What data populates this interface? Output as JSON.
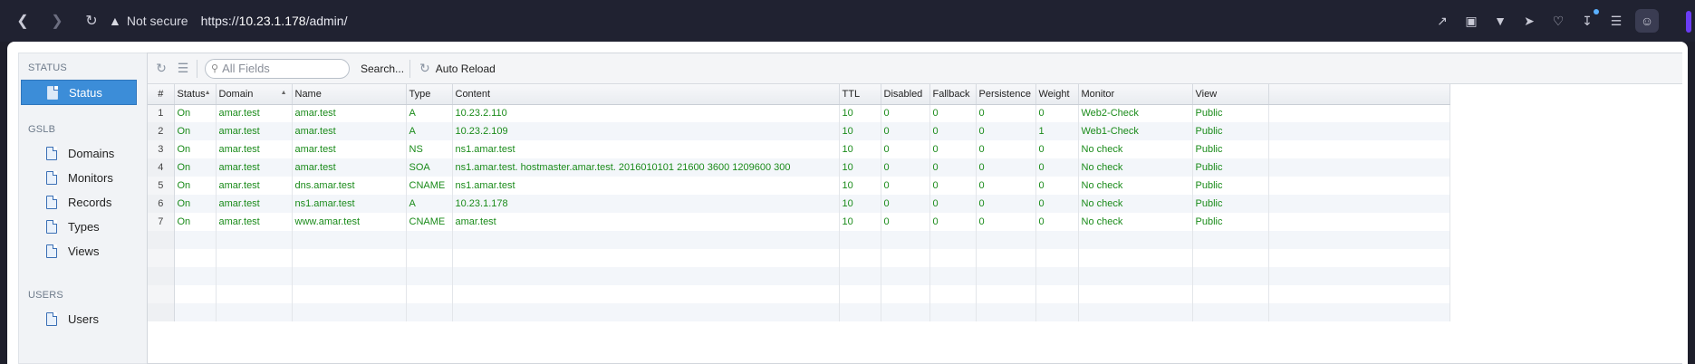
{
  "browser": {
    "security_label": "Not secure",
    "url_prefix": "https://",
    "url_host": "10.23.1.178",
    "url_path": "/admin/"
  },
  "sidebar": {
    "sections": {
      "status": "STATUS",
      "gslb": "GSLB",
      "users": "USERS"
    },
    "items": {
      "status": "Status",
      "domains": "Domains",
      "monitors": "Monitors",
      "records": "Records",
      "types": "Types",
      "views": "Views",
      "users": "Users"
    },
    "active": "Status"
  },
  "toolbar": {
    "search_placeholder": "All Fields",
    "search_button": "Search...",
    "auto_reload": "Auto Reload"
  },
  "table": {
    "columns": [
      "#",
      "Status",
      "Domain",
      "Name",
      "Type",
      "Content",
      "TTL",
      "Disabled",
      "Fallback",
      "Persistence",
      "Weight",
      "Monitor",
      "View"
    ],
    "rows": [
      [
        "1",
        "On",
        "amar.test",
        "amar.test",
        "A",
        "10.23.2.110",
        "10",
        "0",
        "0",
        "0",
        "0",
        "Web2-Check",
        "Public"
      ],
      [
        "2",
        "On",
        "amar.test",
        "amar.test",
        "A",
        "10.23.2.109",
        "10",
        "0",
        "0",
        "0",
        "1",
        "Web1-Check",
        "Public"
      ],
      [
        "3",
        "On",
        "amar.test",
        "amar.test",
        "NS",
        "ns1.amar.test",
        "10",
        "0",
        "0",
        "0",
        "0",
        "No check",
        "Public"
      ],
      [
        "4",
        "On",
        "amar.test",
        "amar.test",
        "SOA",
        "ns1.amar.test. hostmaster.amar.test. 2016010101 21600 3600 1209600 300",
        "10",
        "0",
        "0",
        "0",
        "0",
        "No check",
        "Public"
      ],
      [
        "5",
        "On",
        "amar.test",
        "dns.amar.test",
        "CNAME",
        "ns1.amar.test",
        "10",
        "0",
        "0",
        "0",
        "0",
        "No check",
        "Public"
      ],
      [
        "6",
        "On",
        "amar.test",
        "ns1.amar.test",
        "A",
        "10.23.1.178",
        "10",
        "0",
        "0",
        "0",
        "0",
        "No check",
        "Public"
      ],
      [
        "7",
        "On",
        "amar.test",
        "www.amar.test",
        "CNAME",
        "amar.test",
        "10",
        "0",
        "0",
        "0",
        "0",
        "No check",
        "Public"
      ]
    ]
  },
  "colors": {
    "accent": "#3c8dd8",
    "value_text": "#1a8b1a"
  }
}
